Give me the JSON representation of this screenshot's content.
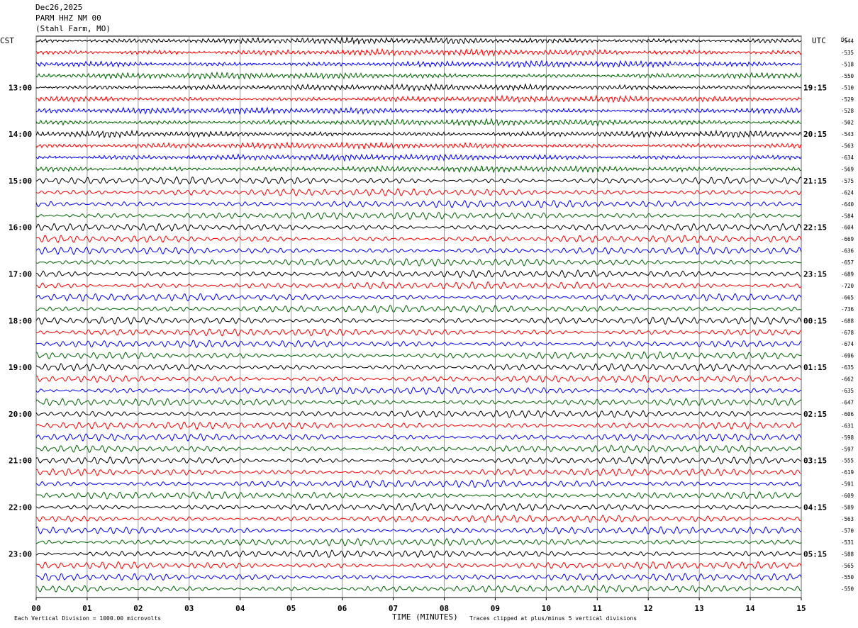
{
  "header": {
    "date": "Dec26,2025",
    "station": "PARM HHZ NM 00",
    "location": "(Stahl Farm, MO)"
  },
  "labels": {
    "left_tz": "CST",
    "right_tz": "UTC",
    "dc": "DC",
    "x_title": "TIME (MINUTES)",
    "scale_note": "Each Vertical Division = 1000.00 microvolts",
    "clip_note": "Traces clipped at plus/minus 5 vertical divisions"
  },
  "chart_data": {
    "type": "line",
    "title": "",
    "xlabel": "TIME (MINUTES)",
    "ylabel": "",
    "xlim": [
      0,
      15
    ],
    "x_ticks": [
      "00",
      "01",
      "02",
      "03",
      "04",
      "05",
      "06",
      "07",
      "08",
      "09",
      "10",
      "11",
      "12",
      "13",
      "14",
      "15"
    ],
    "grid": "vertical",
    "series_colors": [
      "#000000",
      "#ff0000",
      "#0000ff",
      "#006400"
    ],
    "left_hour_labels": [
      "13:00",
      "14:00",
      "15:00",
      "16:00",
      "17:00",
      "18:00",
      "19:00",
      "20:00",
      "21:00",
      "22:00",
      "23:00"
    ],
    "right_hour_labels": [
      "19:15",
      "20:15",
      "21:15",
      "22:15",
      "23:15",
      "00:15",
      "01:15",
      "02:15",
      "03:15",
      "04:15",
      "05:15"
    ],
    "dc_offsets": [
      -544,
      -535,
      -518,
      -550,
      -510,
      -529,
      -528,
      -502,
      -543,
      -563,
      -634,
      -569,
      -575,
      -624,
      -640,
      -584,
      -604,
      -669,
      -636,
      -657,
      -689,
      -720,
      -665,
      -736,
      -688,
      -678,
      -674,
      -696,
      -635,
      -662,
      -635,
      -647,
      -606,
      -631,
      -598,
      -597,
      -555,
      -619,
      -591,
      -609,
      -589,
      -563,
      -570,
      -531,
      -588,
      -565,
      -550,
      -550
    ]
  }
}
